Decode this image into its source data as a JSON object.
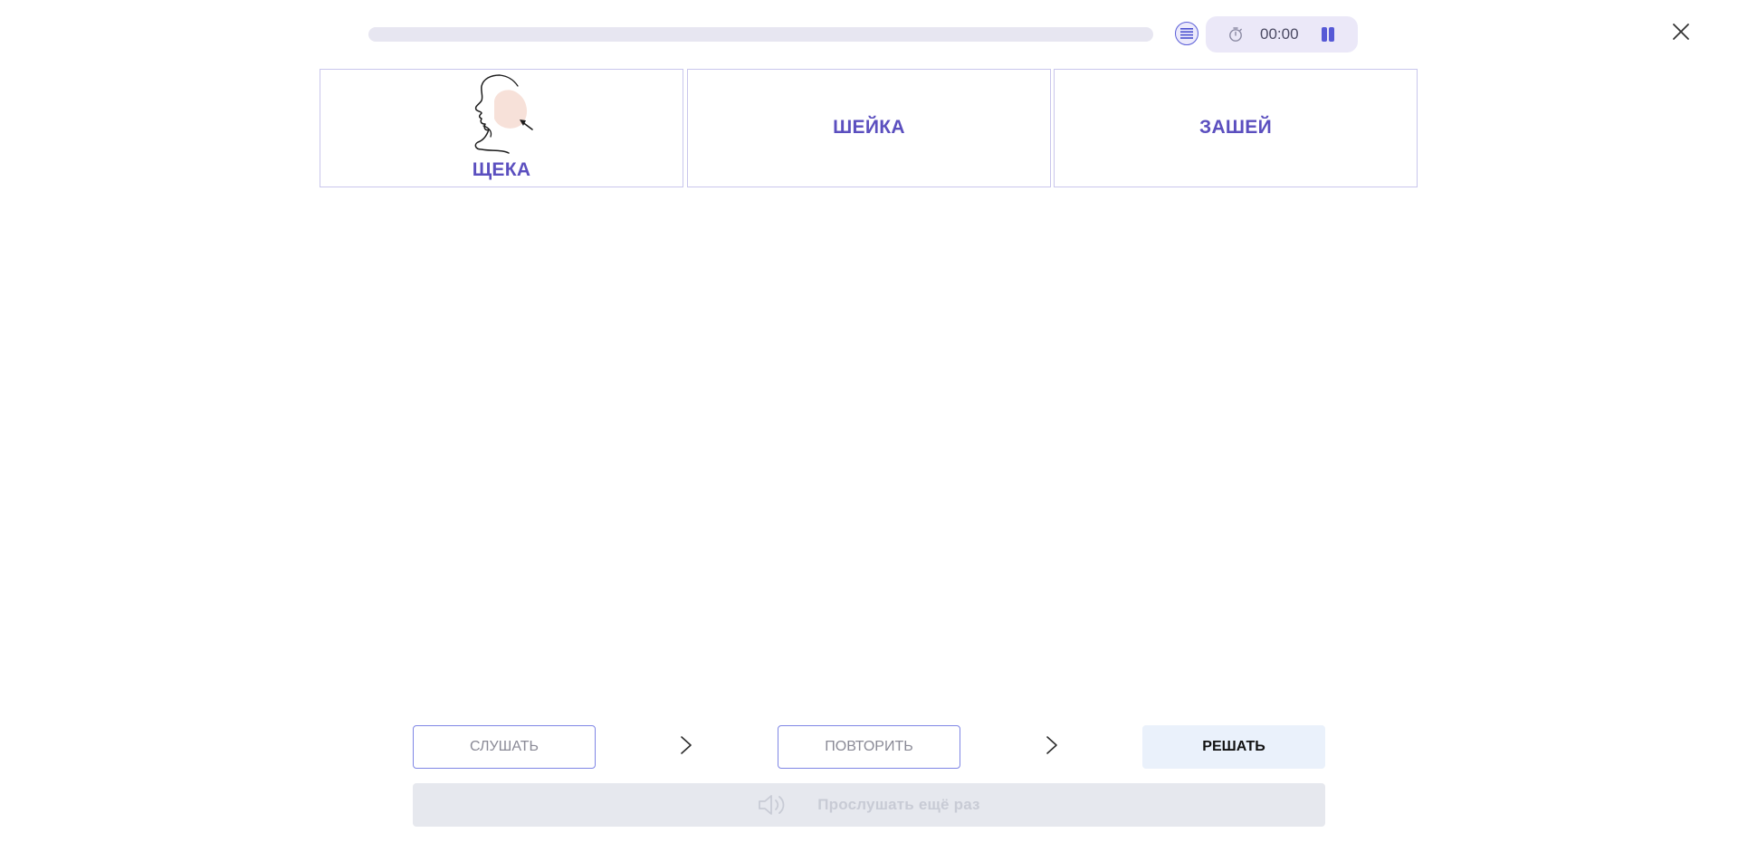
{
  "topbar": {
    "progress_percent": 0,
    "timer": "00:00",
    "icons": {
      "list": "list-icon",
      "timer": "stopwatch-icon",
      "pause": "pause-icon",
      "close": "close-icon"
    }
  },
  "cards": [
    {
      "label": "ЩЕКА",
      "has_image": true,
      "image": "face-cheek-illustration"
    },
    {
      "label": "ШЕЙКА",
      "has_image": false
    },
    {
      "label": "ЗАШЕЙ",
      "has_image": false
    }
  ],
  "steps": {
    "listen": "СЛУШАТЬ",
    "repeat": "ПОВТОРИТЬ",
    "solve": "РЕШАТЬ"
  },
  "replay": {
    "label": "Прослушать ещё раз",
    "icon": "speaker-icon",
    "enabled": false
  },
  "colors": {
    "accent": "#5b4fbf",
    "progress_track": "#e7e6f1",
    "card_border": "#c9c6ec",
    "timer_bg": "#ebe8f8",
    "solve_bg": "#eaf1fb",
    "replay_bg": "#e6e8ee"
  }
}
